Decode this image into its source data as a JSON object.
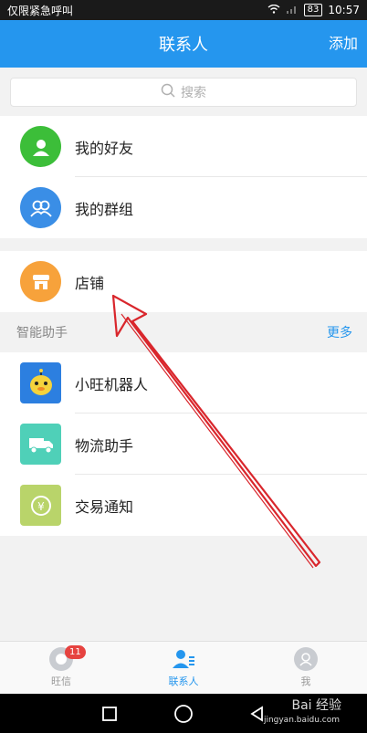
{
  "status": {
    "carrier": "仅限紧急呼叫",
    "battery": "83",
    "time": "10:57"
  },
  "header": {
    "title": "联系人",
    "add_label": "添加"
  },
  "search": {
    "placeholder": "搜索"
  },
  "group1": [
    {
      "label": "我的好友",
      "icon": "friend-icon",
      "color": "#3cbe39"
    },
    {
      "label": "我的群组",
      "icon": "group-icon",
      "color": "#3a8ee6"
    }
  ],
  "group2": [
    {
      "label": "店铺",
      "icon": "shop-icon",
      "color": "#f7a23b"
    }
  ],
  "assistant": {
    "section_label": "智能助手",
    "more_label": "更多"
  },
  "group3": [
    {
      "label": "小旺机器人",
      "icon": "robot-icon",
      "color": "#2c7fe0"
    },
    {
      "label": "物流助手",
      "icon": "truck-icon",
      "color": "#4fd0b8"
    },
    {
      "label": "交易通知",
      "icon": "trade-icon",
      "color": "#b9d46a"
    }
  ],
  "tabs": [
    {
      "label": "旺信",
      "badge": "11"
    },
    {
      "label": "联系人"
    },
    {
      "label": "我"
    }
  ],
  "watermark": {
    "text": "Bai 经验",
    "sub": "jingyan.baidu.com"
  },
  "colors": {
    "accent": "#2596ee",
    "annotation": "#d9262c"
  }
}
